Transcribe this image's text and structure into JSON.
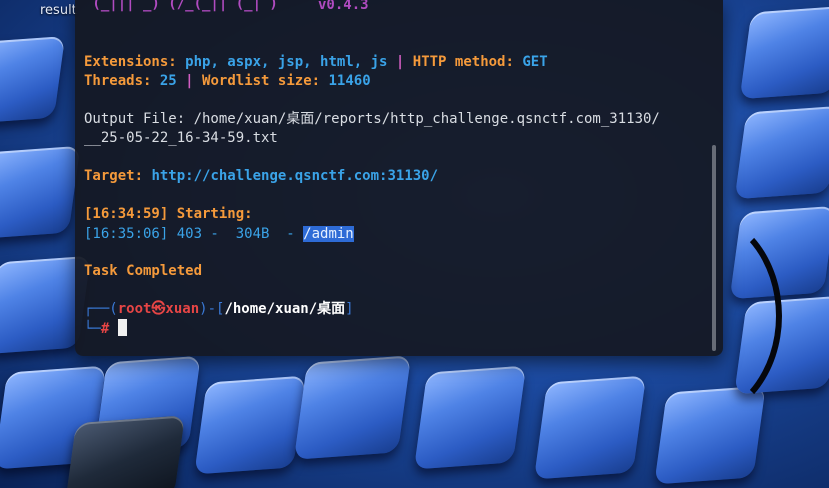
{
  "desktop": {
    "label": "result"
  },
  "terminal": {
    "banner_line": " (_||| _) (/_(_|| (_| )",
    "version": "v0.4.3",
    "extensions_label": "Extensions:",
    "extensions_value": "php, aspx, jsp, html, js",
    "pipe": "|",
    "http_method_label": "HTTP method:",
    "http_method_value": "GET",
    "threads_label": "Threads:",
    "threads_value": "25",
    "wordlist_label": "Wordlist size:",
    "wordlist_value": "11460",
    "output_line1": "Output File: /home/xuan/桌面/reports/http_challenge.qsnctf.com_31130/",
    "output_line2": "__25-05-22_16-34-59.txt",
    "target_label": "Target:",
    "target_value": "http://challenge.qsnctf.com:31130/",
    "starting_line": "[16:34:59] Starting:",
    "result": {
      "prefix": "[16:35:06] 403 -  304B  - ",
      "path": "/admin"
    },
    "completed": "Task Completed",
    "prompt": {
      "open": "┌──(",
      "user": "root㉿xuan",
      "mid": ")-[",
      "path": "/home/xuan/桌面",
      "close": "]",
      "line2": "└─",
      "symbol": "#"
    }
  }
}
